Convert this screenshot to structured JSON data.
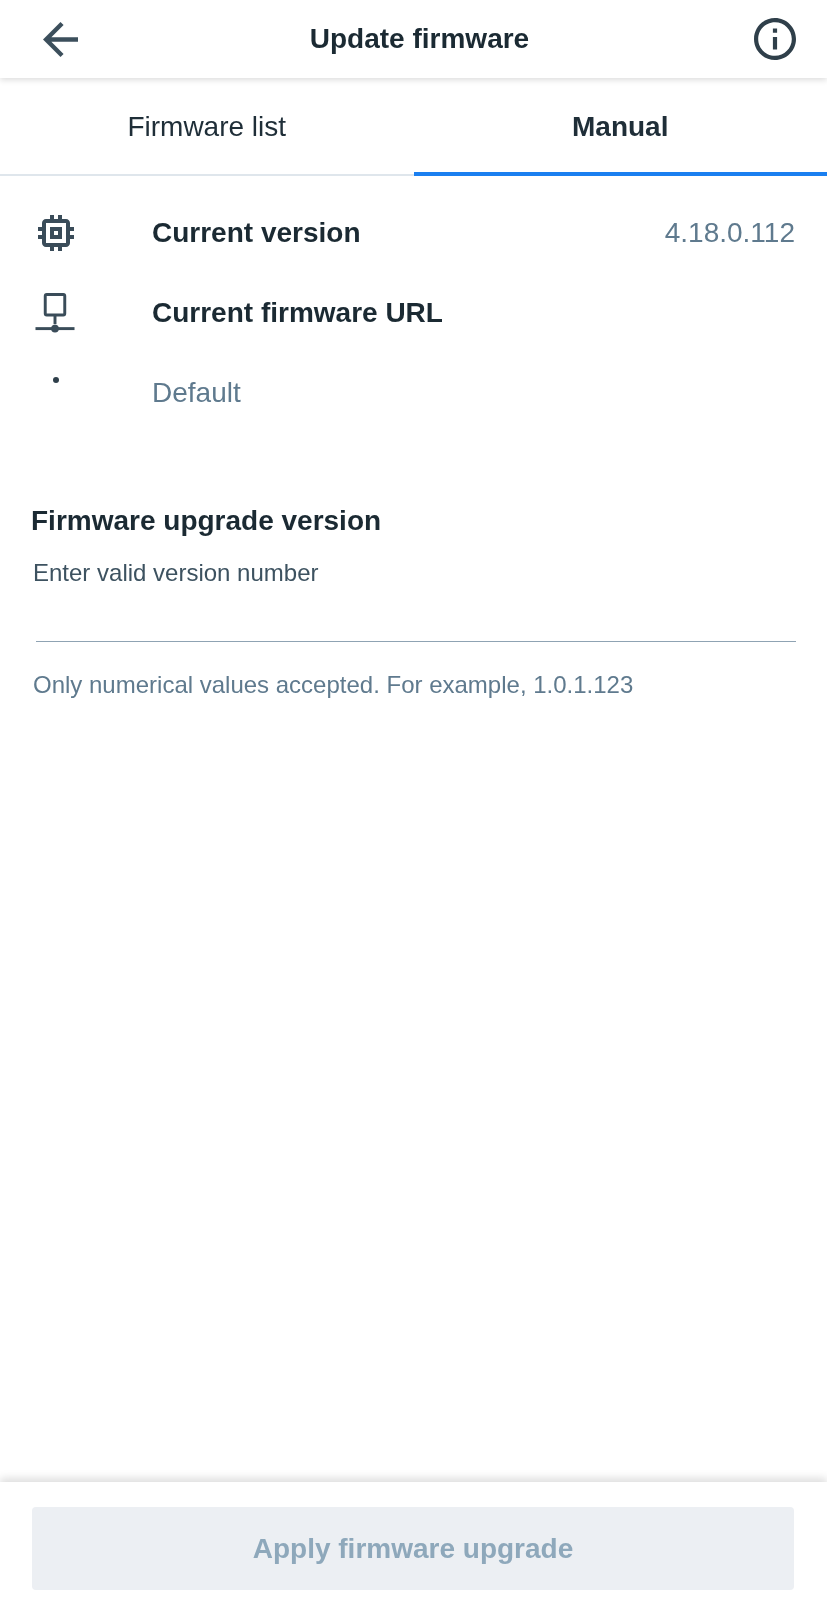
{
  "header": {
    "title": "Update firmware"
  },
  "tabs": [
    {
      "label": "Firmware list",
      "selected": false
    },
    {
      "label": "Manual",
      "selected": true
    }
  ],
  "info_rows": [
    {
      "kind": "chip",
      "label": "Current version",
      "value": "4.18.0.112"
    },
    {
      "kind": "network",
      "label": "Current firmware URL"
    },
    {
      "kind": "bullet",
      "value": "Default"
    }
  ],
  "upgrade_field": {
    "title": "Firmware upgrade version",
    "label": "Enter valid version number",
    "helper": "Only numerical values accepted. For example, 1.0.1.123"
  },
  "apply_button": {
    "label": "Apply firmware upgrade",
    "disabled": true
  }
}
